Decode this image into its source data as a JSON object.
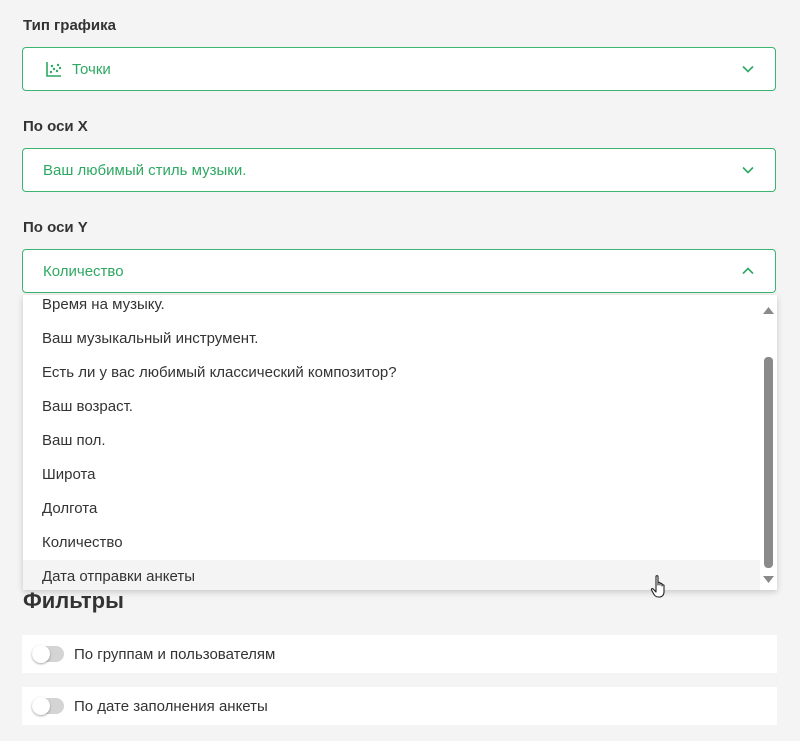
{
  "chart_type_field": {
    "label": "Тип графика",
    "value": "Точки",
    "icon": "scatter-chart-icon"
  },
  "x_axis_field": {
    "label": "По оси X",
    "value": "Ваш любимый стиль музыки."
  },
  "y_axis_field": {
    "label": "По оси Y",
    "value": "Количество",
    "expanded": true
  },
  "y_axis_options": [
    "Время на музыку.",
    "Ваш музыкальный инструмент.",
    "Есть ли у вас любимый классический композитор?",
    "Ваш возраст.",
    "Ваш пол.",
    "Широта",
    "Долгота",
    "Количество",
    "Дата отправки анкеты"
  ],
  "filters": {
    "title": "Фильтры",
    "items": [
      {
        "label": "По группам и пользователям",
        "enabled": false
      },
      {
        "label": "По дате заполнения анкеты",
        "enabled": false
      }
    ]
  },
  "colors": {
    "accent": "#3bb371",
    "accent_text": "#2ea862",
    "background": "#f4f4f4",
    "scroll_thumb": "#8a8a8a"
  }
}
